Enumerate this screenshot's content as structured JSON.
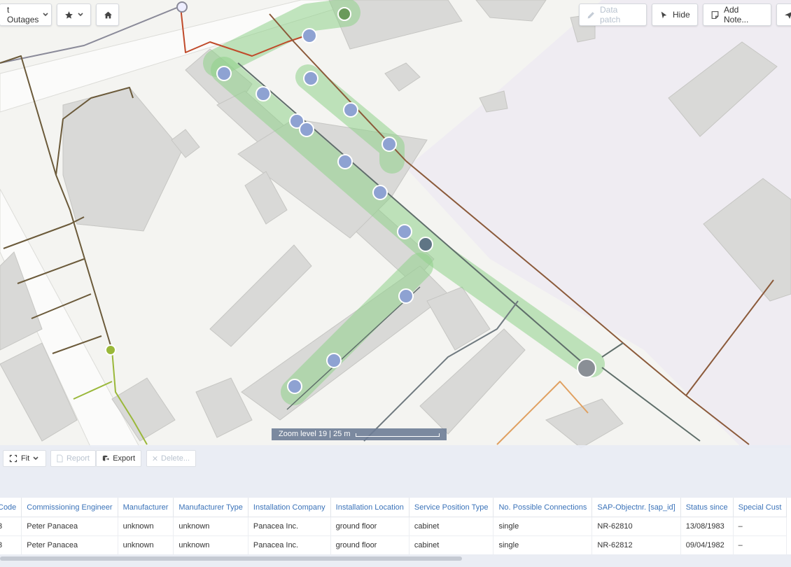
{
  "toolbar": {
    "outages_label": "t Outages",
    "data_patch_label": "Data patch",
    "hide_label": "Hide",
    "add_note_label": "Add Note..."
  },
  "map": {
    "scale_text": "Zoom level 19 | 25 m"
  },
  "panel": {
    "fit_label": "Fit",
    "report_label": "Report",
    "export_label": "Export",
    "delete_label": "Delete..."
  },
  "table": {
    "columns": [
      "Code",
      "Commissioning Engineer",
      "Manufacturer",
      "Manufacturer Type",
      "Installation Company",
      "Installation Location",
      "Service Position Type",
      "No. Possible Connections",
      "SAP-Objectnr. [sap_id]",
      "Status since",
      "Special Cust"
    ],
    "rows": [
      [
        "3",
        "Peter Panacea",
        "unknown",
        "unknown",
        "Panacea Inc.",
        "ground floor",
        "cabinet",
        "single",
        "NR-62810",
        "13/08/1983",
        "–"
      ],
      [
        "3",
        "Peter Panacea",
        "unknown",
        "unknown",
        "Panacea Inc.",
        "ground floor",
        "cabinet",
        "single",
        "NR-62812",
        "09/04/1982",
        "–"
      ]
    ]
  },
  "colors": {
    "highlight": "#8fd18a",
    "accent": "#3b73b9"
  }
}
